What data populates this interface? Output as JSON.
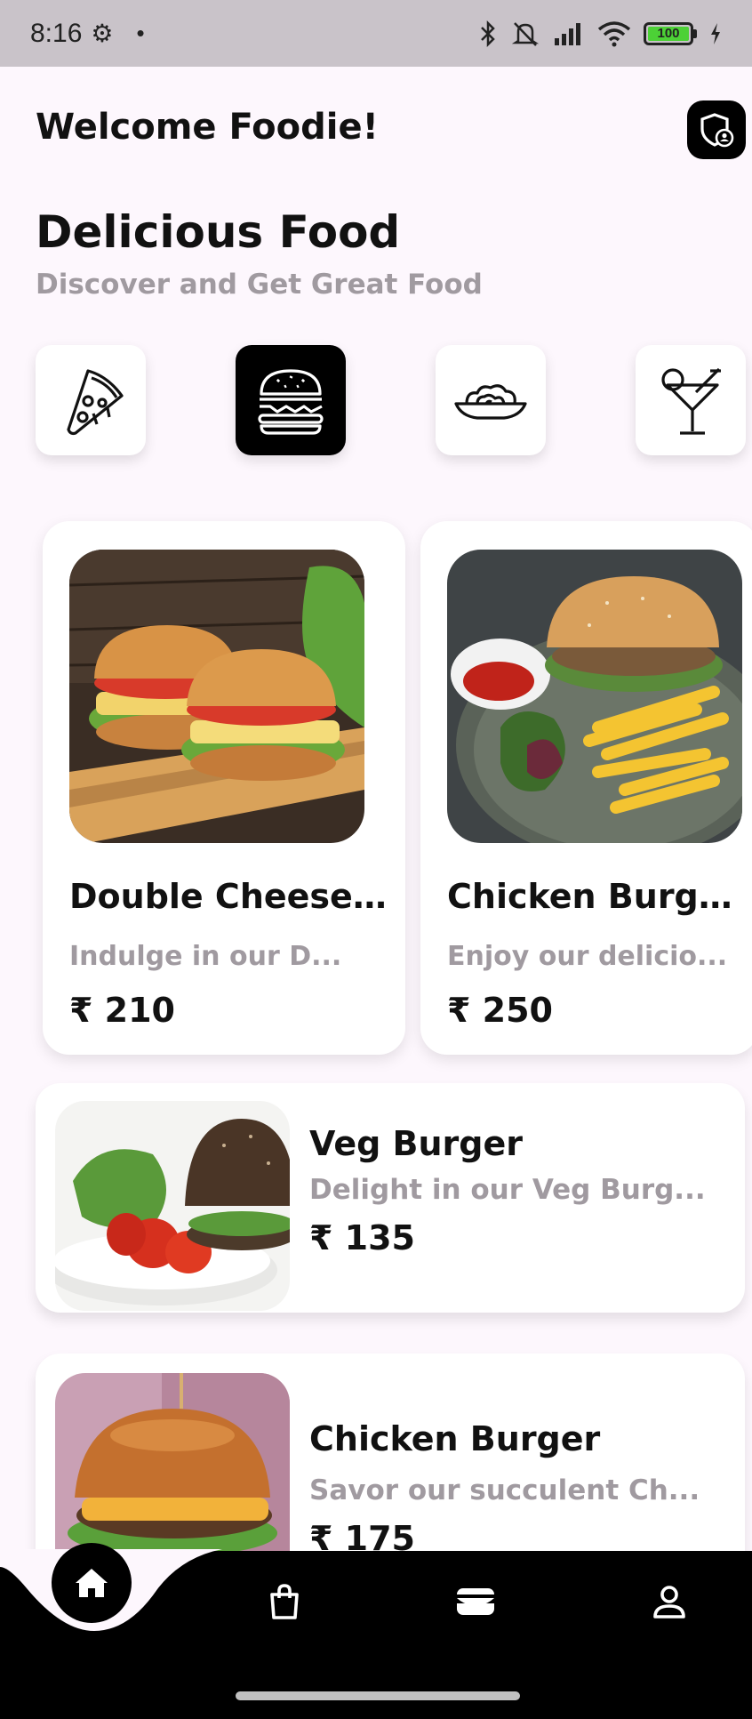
{
  "status_bar": {
    "time": "8:16",
    "battery": "100"
  },
  "header": {
    "welcome": "Welcome Foodie!"
  },
  "hero": {
    "title": "Delicious Food",
    "subtitle": "Discover and Get Great Food"
  },
  "categories": [
    {
      "icon": "pizza-icon",
      "active": false
    },
    {
      "icon": "burger-icon",
      "active": true
    },
    {
      "icon": "noodles-icon",
      "active": false
    },
    {
      "icon": "cocktail-icon",
      "active": false
    }
  ],
  "featured": [
    {
      "name": "Double Cheese...",
      "description": "Indulge in our D...",
      "price": "₹ 210"
    },
    {
      "name": "Chicken Burger...",
      "description": "Enjoy our delicio...",
      "price": "₹ 250"
    }
  ],
  "list": [
    {
      "name": "Veg Burger",
      "description": "Delight in our Veg Burg...",
      "price": "₹ 135"
    },
    {
      "name": "Chicken Burger",
      "description": "Savor our succulent Ch...",
      "price": "₹ 175"
    }
  ],
  "bottom_nav": [
    {
      "icon": "home-icon",
      "active": true
    },
    {
      "icon": "shopping-bag-icon",
      "active": false
    },
    {
      "icon": "wallet-icon",
      "active": false
    },
    {
      "icon": "user-icon",
      "active": false
    }
  ],
  "colors": {
    "accent": "#000000",
    "background": "#fdf7fd",
    "muted_text": "#a09aa0",
    "battery": "#4cd136"
  }
}
